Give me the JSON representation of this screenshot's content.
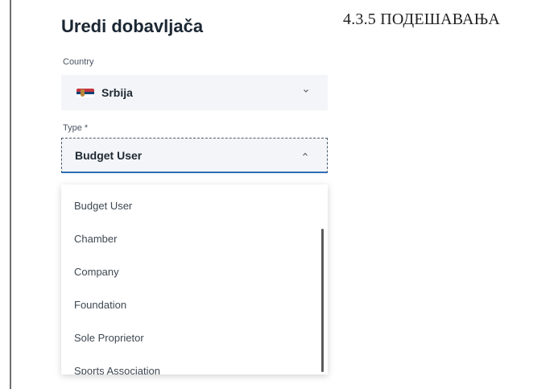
{
  "page": {
    "title": "Uredi dobavljača",
    "section_heading": "4.3.5 ПОДЕШАВАЊА"
  },
  "country_field": {
    "label": "Country",
    "value": "Srbija",
    "flag_icon": "serbia-flag-icon"
  },
  "type_field": {
    "label": "Type *",
    "value": "Budget User",
    "expanded": true,
    "options": [
      "Budget User",
      "Chamber",
      "Company",
      "Foundation",
      "Sole Proprietor",
      "Sports Association"
    ]
  },
  "colors": {
    "focus_underline": "#2f6fb5",
    "field_background": "#f3f5f8",
    "title_text": "#1b2733"
  }
}
